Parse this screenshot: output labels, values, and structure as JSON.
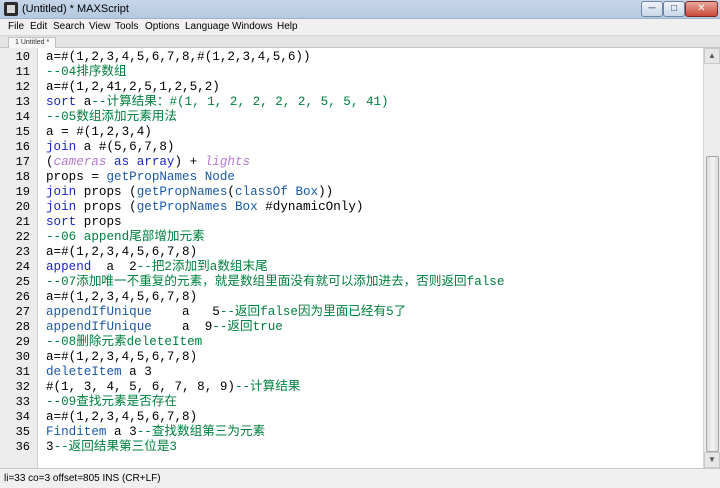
{
  "window": {
    "title": "(Untitled) * MAXScript",
    "minimize_glyph": "─",
    "maximize_glyph": "□",
    "close_glyph": "✕",
    "app_icon": "maxscript-app-icon"
  },
  "menu": [
    "File",
    "Edit",
    "Search",
    "View",
    "Tools",
    "Options",
    "Language",
    "Windows",
    "Help"
  ],
  "tab": {
    "label": "1 Untitled *"
  },
  "editor": {
    "lines": [
      {
        "num": "10",
        "tokens": [
          {
            "t": "a=#(1,2,3,4,5,6,7,8,#(1,2,3,4,5,6))",
            "c": "normal"
          }
        ]
      },
      {
        "num": "11",
        "tokens": [
          {
            "t": "--04排序数组",
            "c": "comment"
          }
        ]
      },
      {
        "num": "12",
        "tokens": [
          {
            "t": "a=#(1,2,41,2,5,1,2,5,2)",
            "c": "normal"
          }
        ]
      },
      {
        "num": "13",
        "tokens": [
          {
            "t": "sort",
            "c": "keyword"
          },
          {
            "t": " a",
            "c": "normal"
          },
          {
            "t": "--计算结果：#(1, 1, 2, 2, 2, 2, 5, 5, 41)",
            "c": "comment"
          }
        ]
      },
      {
        "num": "14",
        "tokens": [
          {
            "t": "--05数组添加元素用法",
            "c": "comment"
          }
        ]
      },
      {
        "num": "15",
        "tokens": [
          {
            "t": "a = #(1,2,3,4)",
            "c": "normal"
          }
        ]
      },
      {
        "num": "16",
        "tokens": [
          {
            "t": "join",
            "c": "keyword"
          },
          {
            "t": " a #(5,6,7,8)",
            "c": "normal"
          }
        ]
      },
      {
        "num": "17",
        "tokens": [
          {
            "t": "(",
            "c": "normal"
          },
          {
            "t": "cameras",
            "c": "italic"
          },
          {
            "t": " as ",
            "c": "keyword"
          },
          {
            "t": "array",
            "c": "keyword"
          },
          {
            "t": ") + ",
            "c": "normal"
          },
          {
            "t": "lights",
            "c": "italic"
          }
        ]
      },
      {
        "num": "18",
        "tokens": [
          {
            "t": "props = ",
            "c": "normal"
          },
          {
            "t": "getPropNames",
            "c": "func"
          },
          {
            "t": " ",
            "c": "normal"
          },
          {
            "t": "Node",
            "c": "builtin"
          }
        ]
      },
      {
        "num": "19",
        "tokens": [
          {
            "t": "join",
            "c": "keyword"
          },
          {
            "t": " props (",
            "c": "normal"
          },
          {
            "t": "getPropNames",
            "c": "func"
          },
          {
            "t": "(",
            "c": "normal"
          },
          {
            "t": "classOf",
            "c": "func"
          },
          {
            "t": " ",
            "c": "normal"
          },
          {
            "t": "Box",
            "c": "builtin"
          },
          {
            "t": "))",
            "c": "normal"
          }
        ]
      },
      {
        "num": "20",
        "tokens": [
          {
            "t": "join",
            "c": "keyword"
          },
          {
            "t": " props (",
            "c": "normal"
          },
          {
            "t": "getPropNames",
            "c": "func"
          },
          {
            "t": " ",
            "c": "normal"
          },
          {
            "t": "Box",
            "c": "builtin"
          },
          {
            "t": " #dynamicOnly)",
            "c": "normal"
          }
        ]
      },
      {
        "num": "21",
        "tokens": [
          {
            "t": "sort",
            "c": "keyword"
          },
          {
            "t": " props",
            "c": "normal"
          }
        ]
      },
      {
        "num": "22",
        "tokens": [
          {
            "t": "--06 append尾部增加元素",
            "c": "comment"
          }
        ]
      },
      {
        "num": "23",
        "tokens": [
          {
            "t": "a=#(1,2,3,4,5,6,7,8)",
            "c": "normal"
          }
        ]
      },
      {
        "num": "24",
        "tokens": [
          {
            "t": "append",
            "c": "keyword"
          },
          {
            "t": "  a  2",
            "c": "normal"
          },
          {
            "t": "--把2添加到a数组末尾",
            "c": "comment"
          }
        ]
      },
      {
        "num": "25",
        "tokens": [
          {
            "t": "--07添加唯一不重复的元素，就是数组里面没有就可以添加进去，否则返回false",
            "c": "comment"
          }
        ]
      },
      {
        "num": "26",
        "tokens": [
          {
            "t": "a=#(1,2,3,4,5,6,7,8)",
            "c": "normal"
          }
        ]
      },
      {
        "num": "27",
        "tokens": [
          {
            "t": "appendIfUnique",
            "c": "func"
          },
          {
            "t": "    a   5",
            "c": "normal"
          },
          {
            "t": "--返回false因为里面已经有5了",
            "c": "comment"
          }
        ]
      },
      {
        "num": "28",
        "tokens": [
          {
            "t": "appendIfUnique",
            "c": "func"
          },
          {
            "t": "    a  9",
            "c": "normal"
          },
          {
            "t": "--返回true",
            "c": "comment"
          }
        ]
      },
      {
        "num": "29",
        "tokens": [
          {
            "t": "--08删除元素deleteItem",
            "c": "comment"
          }
        ]
      },
      {
        "num": "30",
        "tokens": [
          {
            "t": "a=#(1,2,3,4,5,6,7,8)",
            "c": "normal"
          }
        ]
      },
      {
        "num": "31",
        "tokens": [
          {
            "t": "deleteItem",
            "c": "func"
          },
          {
            "t": " a 3",
            "c": "normal"
          }
        ]
      },
      {
        "num": "32",
        "tokens": [
          {
            "t": "#(1, 3, 4, 5, 6, 7, 8, 9)",
            "c": "normal"
          },
          {
            "t": "--计算结果",
            "c": "comment"
          }
        ]
      },
      {
        "num": "33",
        "tokens": [
          {
            "t": "--09查找元素是否存在",
            "c": "comment"
          }
        ]
      },
      {
        "num": "34",
        "tokens": [
          {
            "t": "a=#(1,2,3,4,5,6,7,8)",
            "c": "normal"
          }
        ]
      },
      {
        "num": "35",
        "tokens": [
          {
            "t": "Finditem",
            "c": "func"
          },
          {
            "t": " a 3",
            "c": "normal"
          },
          {
            "t": "--查找数组第三为元素",
            "c": "comment"
          }
        ]
      },
      {
        "num": "36",
        "tokens": [
          {
            "t": "3",
            "c": "normal"
          },
          {
            "t": "--返回结果第三位是3",
            "c": "comment"
          }
        ]
      }
    ]
  },
  "scrollbar": {
    "up_glyph": "▲",
    "down_glyph": "▼"
  },
  "status": {
    "text": "li=33 co=3 offset=805 INS (CR+LF)"
  }
}
